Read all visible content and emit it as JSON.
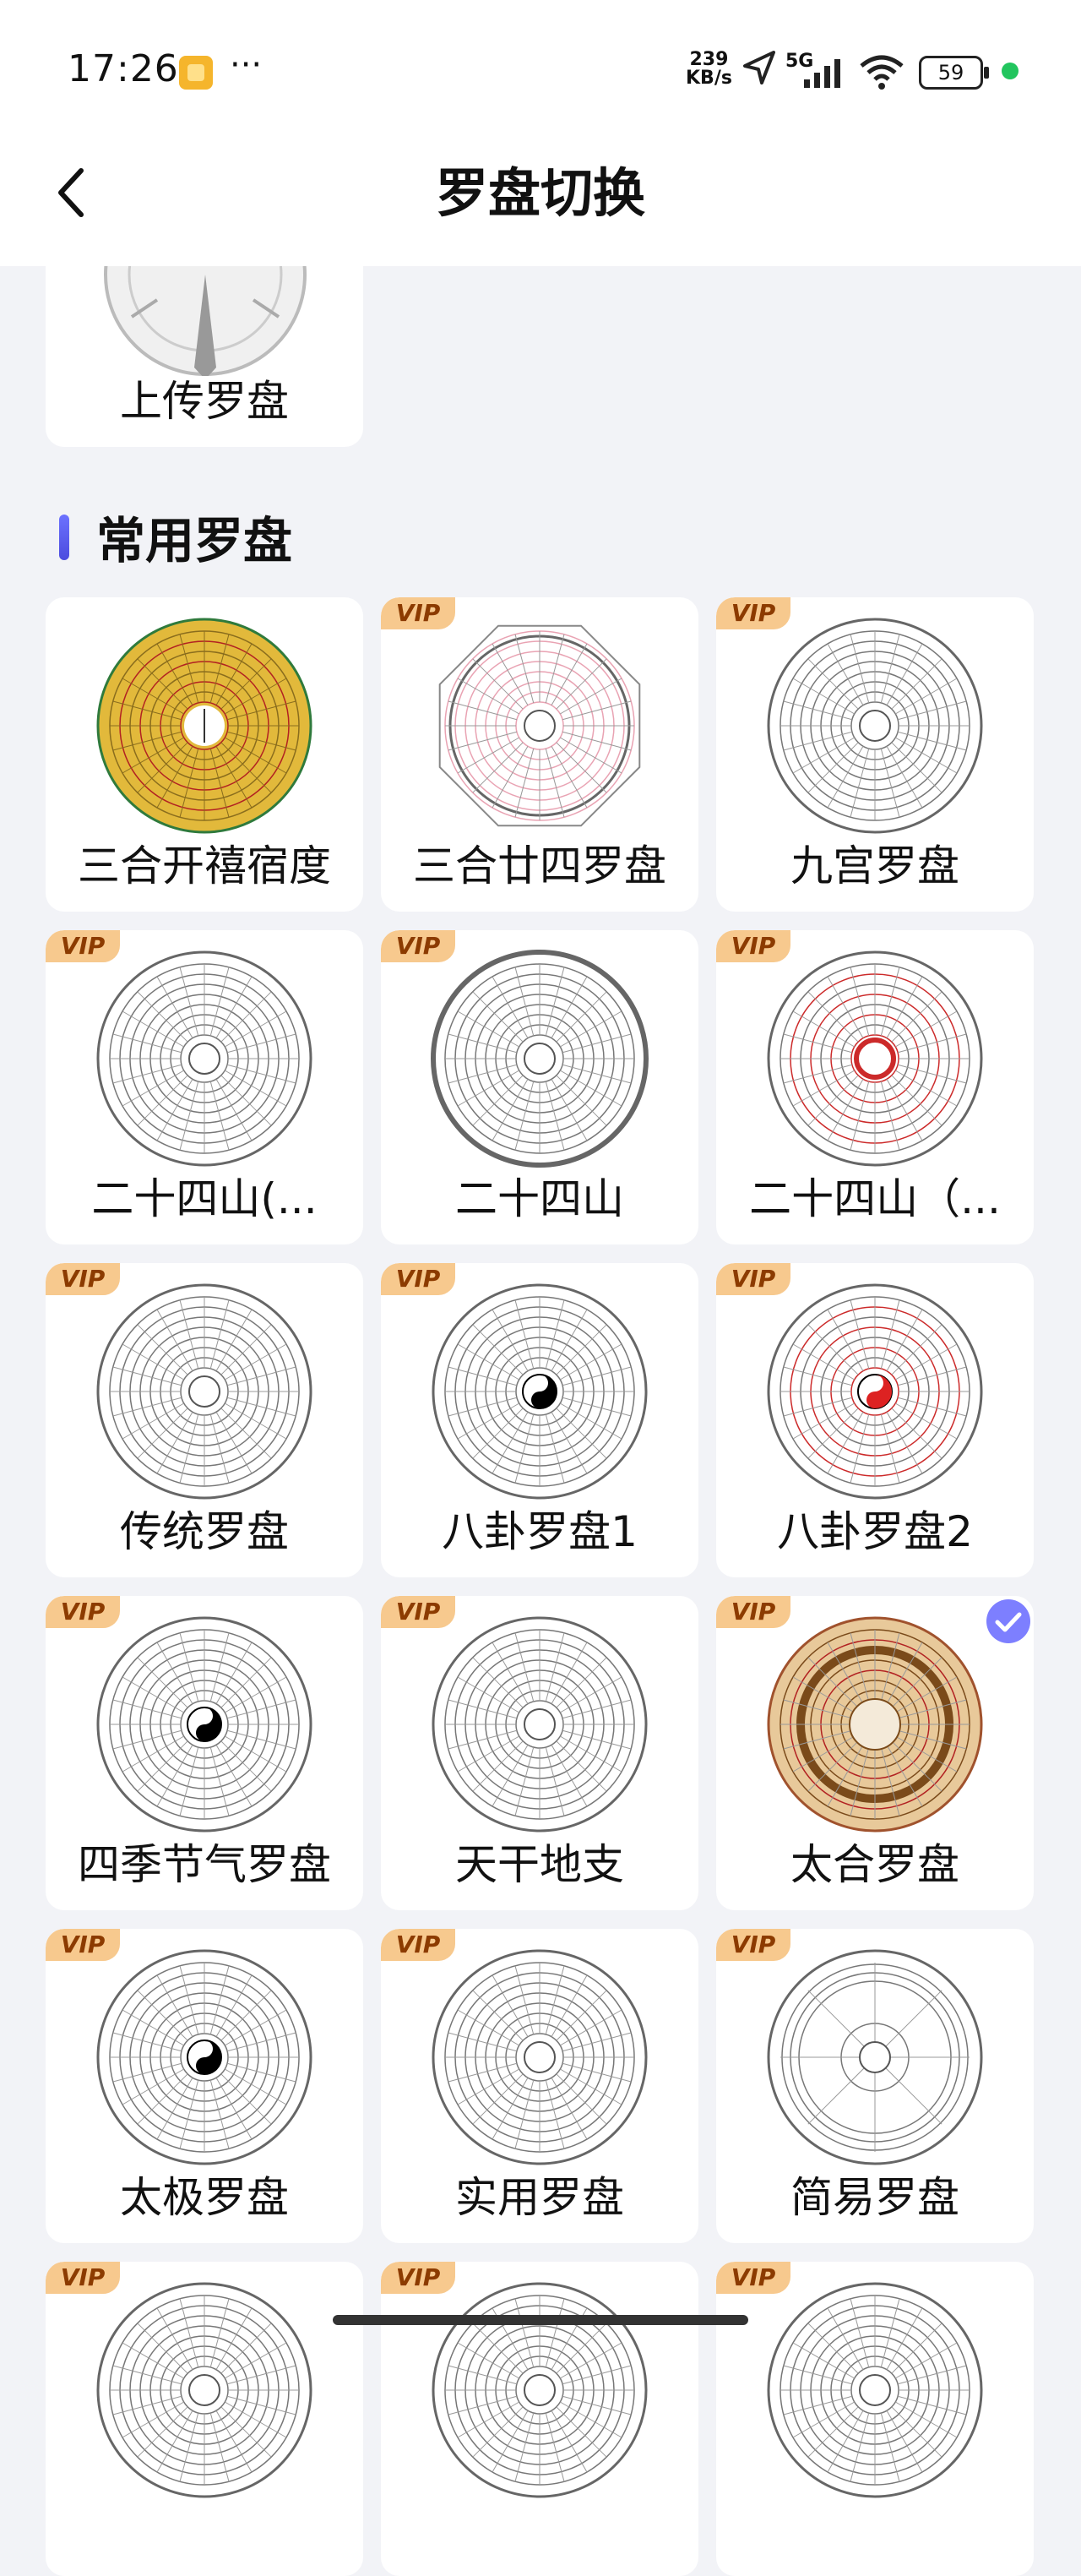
{
  "status_bar": {
    "time": "17:26",
    "network_speed_value": "239",
    "network_speed_unit": "KB/s",
    "signal": "5G",
    "battery": "59"
  },
  "nav": {
    "title": "罗盘切换"
  },
  "upload_card": {
    "label": "上传罗盘"
  },
  "section": {
    "title": "常用罗盘"
  },
  "vip_badge": "VIP",
  "compasses": [
    {
      "label": "三合开禧宿度",
      "vip": false,
      "style": "gold"
    },
    {
      "label": "三合廿四罗盘",
      "vip": true,
      "style": "octagon"
    },
    {
      "label": "九宫罗盘",
      "vip": true,
      "style": "lines"
    },
    {
      "label": "二十四山(...",
      "vip": true,
      "style": "lines"
    },
    {
      "label": "二十四山",
      "vip": true,
      "style": "brown"
    },
    {
      "label": "二十四山（...",
      "vip": true,
      "style": "redcenter"
    },
    {
      "label": "传统罗盘",
      "vip": true,
      "style": "lines"
    },
    {
      "label": "八卦罗盘1",
      "vip": true,
      "style": "taiji"
    },
    {
      "label": "八卦罗盘2",
      "vip": true,
      "style": "redtaiji"
    },
    {
      "label": "四季节气罗盘",
      "vip": true,
      "style": "taiji"
    },
    {
      "label": "天干地支",
      "vip": true,
      "style": "lines"
    },
    {
      "label": "太合罗盘",
      "vip": true,
      "style": "taihe",
      "selected": true
    },
    {
      "label": "太极罗盘",
      "vip": true,
      "style": "taiji"
    },
    {
      "label": "实用罗盘",
      "vip": true,
      "style": "lines"
    },
    {
      "label": "简易罗盘",
      "vip": true,
      "style": "simple"
    },
    {
      "label": "",
      "vip": true,
      "style": "lines"
    },
    {
      "label": "",
      "vip": true,
      "style": "lines"
    },
    {
      "label": "",
      "vip": true,
      "style": "lines"
    }
  ],
  "colors": {
    "background": "#f2f3f7",
    "vip_bg": "#f7c98e",
    "vip_text": "#8c3b00",
    "accent": "#6c72ff"
  }
}
